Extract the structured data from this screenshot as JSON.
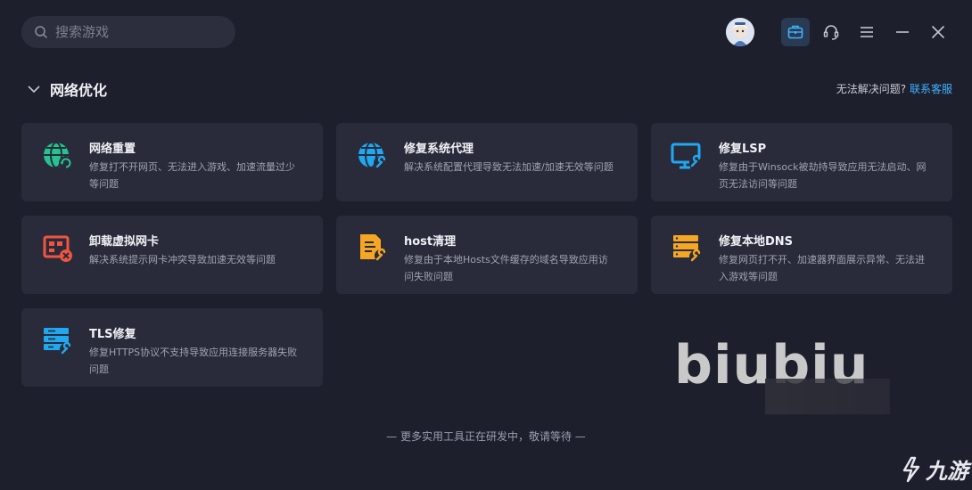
{
  "search": {
    "placeholder": "搜索游戏"
  },
  "section": {
    "title": "网络优化",
    "help_text": "无法解决问题?",
    "help_link": "联系客服"
  },
  "cards": [
    {
      "title": "网络重置",
      "desc": "修复打不开网页、无法进入游戏、加速流量过少等问题",
      "icon": "globe-refresh-icon",
      "color": "#26c28f"
    },
    {
      "title": "修复系统代理",
      "desc": "解决系统配置代理导致无法加速/加速无效等问题",
      "icon": "globe-wrench-icon",
      "color": "#20a8f0"
    },
    {
      "title": "修复LSP",
      "desc": "修复由于Winsock被劫持导致应用无法启动、网页无法访问等问题",
      "icon": "monitor-wrench-icon",
      "color": "#20a8f0"
    },
    {
      "title": "卸载虚拟网卡",
      "desc": "解决系统提示网卡冲突导致加速无效等问题",
      "icon": "network-card-remove-icon",
      "color": "#f0553f"
    },
    {
      "title": "host清理",
      "desc": "修复由于本地Hosts文件缓存的域名导致应用访问失败问题",
      "icon": "file-wrench-icon",
      "color": "#f5a623"
    },
    {
      "title": "修复本地DNS",
      "desc": "修复网页打不开、加速器界面展示异常、无法进入游戏等问题",
      "icon": "server-wrench-icon",
      "color": "#f5a623"
    },
    {
      "title": "TLS修复",
      "desc": "修复HTTPS协议不支持导致应用连接服务器失败问题",
      "icon": "server-shield-icon",
      "color": "#20a8f0"
    }
  ],
  "footer_note": "— 更多实用工具正在研发中，敬请等待 —",
  "watermark": "biubiu",
  "corner_logo": "九游"
}
